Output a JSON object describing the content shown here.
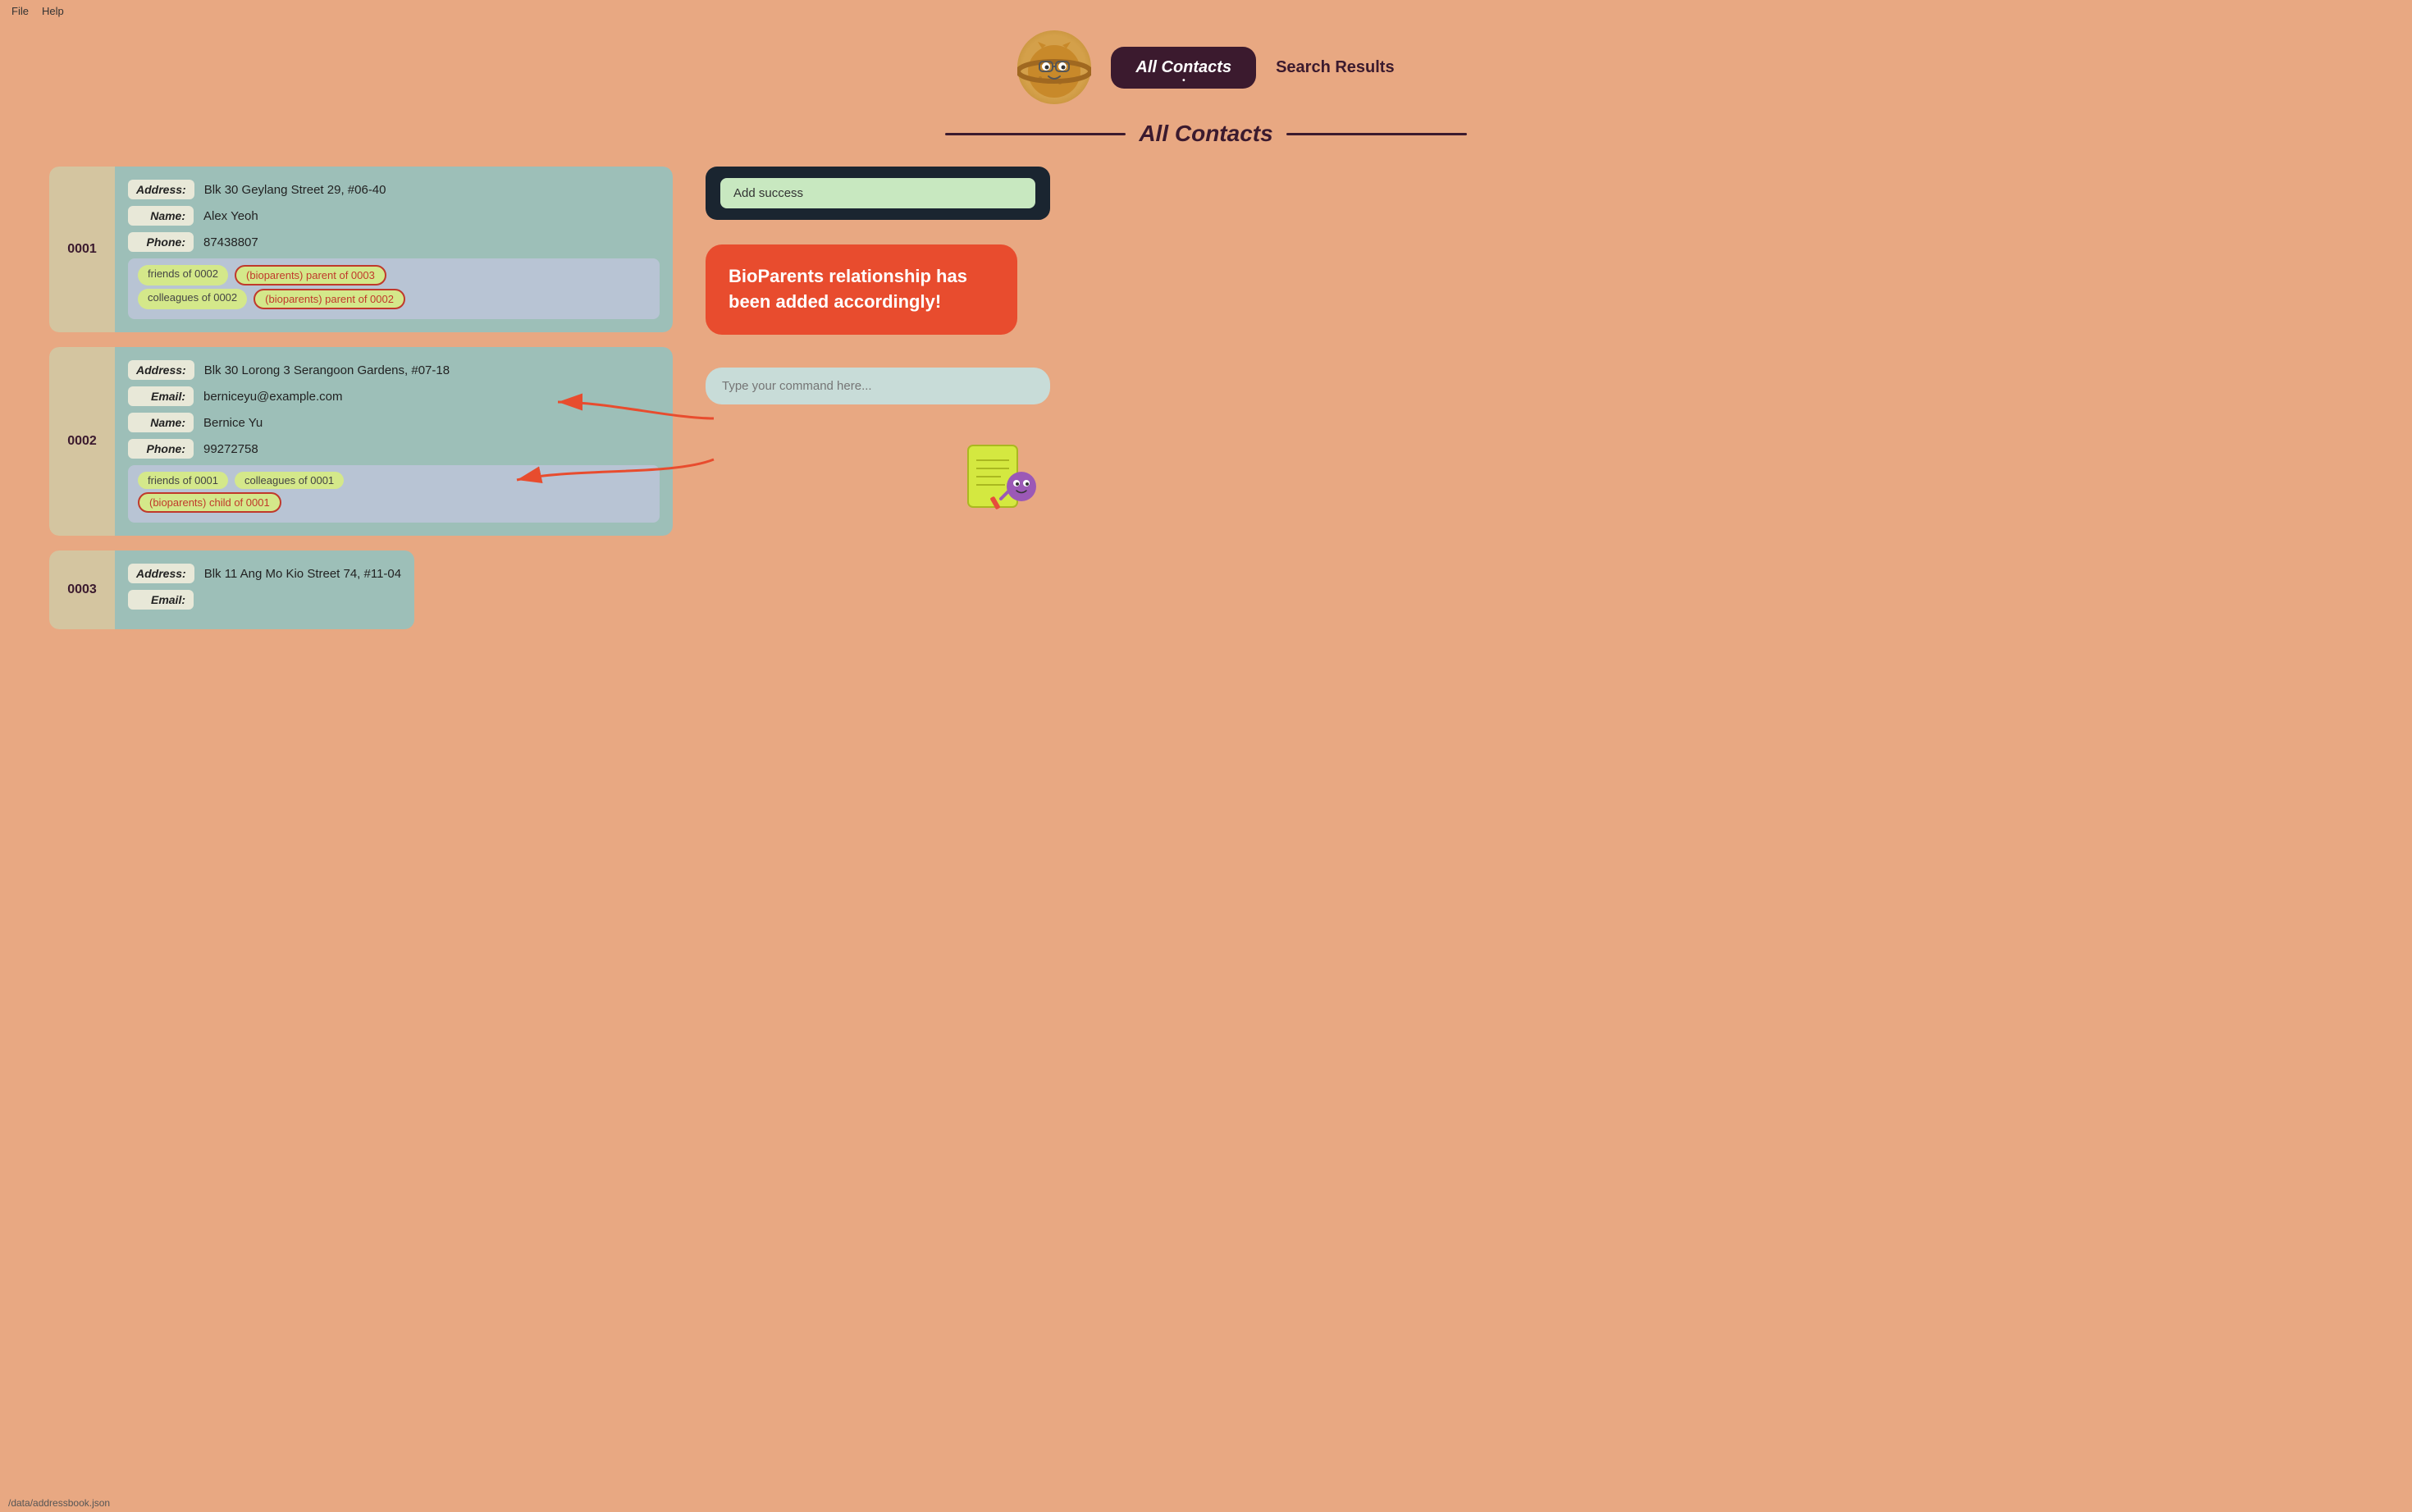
{
  "menubar": {
    "file": "File",
    "help": "Help"
  },
  "header": {
    "nav_active": "All Contacts",
    "nav_inactive": "Search Results"
  },
  "page_title": "All Contacts",
  "notification": {
    "message": "Add success"
  },
  "contacts": [
    {
      "id": "0001",
      "address": "Blk 30 Geylang Street 29, #06-40",
      "name": "Alex Yeoh",
      "phone": "87438807",
      "tags_row1": [
        "friends of 0002",
        "(bioparents) parent of 0003"
      ],
      "tags_row2": [
        "colleagues of 0002",
        "(bioparents) parent of 0002"
      ],
      "highlighted_tag_row1": "(bioparents) parent of 0003",
      "highlighted_tag_row2": "(bioparents) parent of 0002"
    },
    {
      "id": "0002",
      "address": "Blk 30 Lorong 3 Serangoon Gardens, #07-18",
      "email": "berniceyu@example.com",
      "name": "Bernice Yu",
      "phone": "99272758",
      "tags_row1": [
        "friends of 0001",
        "colleagues of 0001"
      ],
      "tags_row2": [
        "(bioparents) child of 0001"
      ],
      "highlighted_tag_row2": "(bioparents) child of 0001"
    },
    {
      "id": "0003",
      "address": "Blk 11 Ang Mo Kio Street 74, #11-04",
      "email_label": "Email:"
    }
  ],
  "tooltip": {
    "text": "BioParents relationship has been added accordingly!"
  },
  "command_input": {
    "placeholder": "Type your command here..."
  },
  "status_bar": {
    "path": "/data/addressbook.json"
  }
}
